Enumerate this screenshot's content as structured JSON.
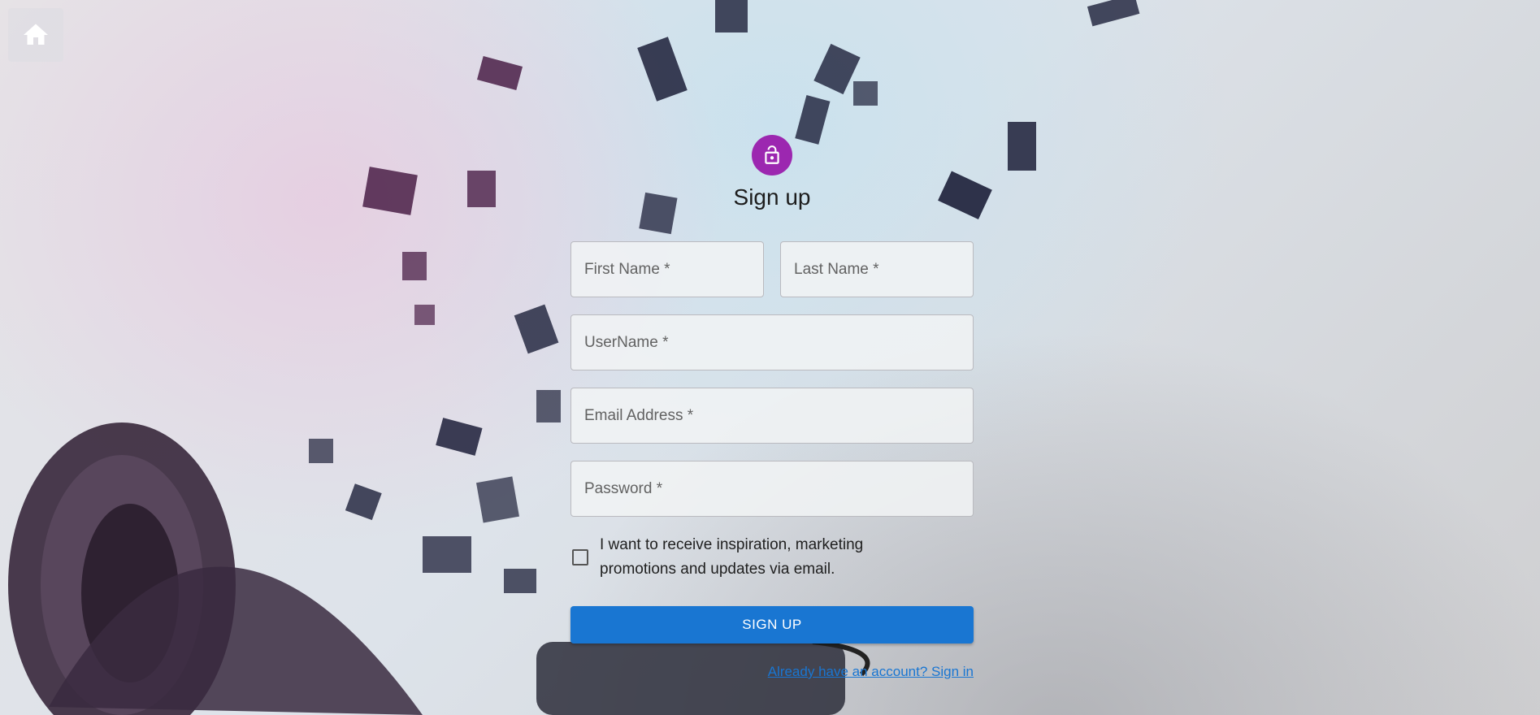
{
  "colors": {
    "avatar": "#9c27b0",
    "primary": "#1976d2",
    "notes_dark": "#1c1f38",
    "notes_purple": "#4a1f47",
    "headphone": "#3a2a3d"
  },
  "icons": {
    "home": "home-icon",
    "avatar": "lock-open-icon"
  },
  "title": "Sign up",
  "fields": {
    "first_name": {
      "placeholder": "First Name *",
      "value": ""
    },
    "last_name": {
      "placeholder": "Last Name *",
      "value": ""
    },
    "username": {
      "placeholder": "UserName *",
      "value": ""
    },
    "email": {
      "placeholder": "Email Address *",
      "value": ""
    },
    "password": {
      "placeholder": "Password *",
      "value": ""
    }
  },
  "checkbox": {
    "label": "I want to receive inspiration, marketing promotions and updates via email.",
    "checked": false
  },
  "submit_label": "SIGN UP",
  "signin_link": "Already have an account? Sign in"
}
